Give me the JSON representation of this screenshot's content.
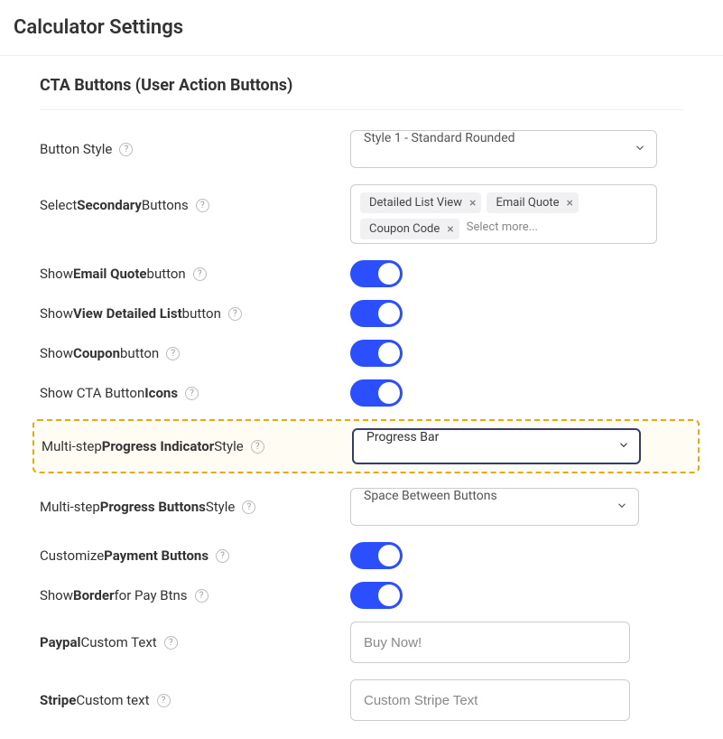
{
  "pageTitle": "Calculator Settings",
  "sectionHeader": "CTA Buttons (User Action Buttons)",
  "rows": {
    "buttonStyle": {
      "label_pre": "Button Style",
      "value": "Style 1 - Standard Rounded"
    },
    "secondaryButtons": {
      "label_pre": "Select ",
      "label_bold": "Secondary",
      "label_post": " Buttons",
      "tags": [
        "Detailed List View",
        "Email Quote",
        "Coupon Code"
      ],
      "placeholder": "Select more..."
    },
    "showEmailQuote": {
      "label_pre": "Show ",
      "label_bold": "Email Quote",
      "label_post": " button",
      "on": true
    },
    "showDetailedList": {
      "label_pre": "Show ",
      "label_bold": "View Detailed List",
      "label_post": " button",
      "on": true
    },
    "showCoupon": {
      "label_pre": "Show ",
      "label_bold": "Coupon",
      "label_post": " button",
      "on": true
    },
    "showCtaIcons": {
      "label_pre": "Show CTA Button ",
      "label_bold": "Icons",
      "on": true
    },
    "progressIndicator": {
      "label_pre": "Multi-step ",
      "label_bold": "Progress Indicator",
      "label_post": " Style",
      "value": "Progress Bar"
    },
    "progressButtons": {
      "label_pre": "Multi-step ",
      "label_bold": "Progress Buttons",
      "label_post": " Style",
      "value": "Space Between Buttons"
    },
    "customizePayment": {
      "label_pre": "Customize ",
      "label_bold": "Payment Buttons",
      "on": true
    },
    "showBorderPay": {
      "label_pre": "Show ",
      "label_bold": "Border",
      "label_post": " for Pay Btns",
      "on": true
    },
    "paypalText": {
      "label_bold": "Paypal",
      "label_post": " Custom Text",
      "placeholder": "Buy Now!"
    },
    "stripeText": {
      "label_bold": "Stripe",
      "label_post": " Custom text",
      "placeholder": "Custom Stripe Text"
    }
  }
}
